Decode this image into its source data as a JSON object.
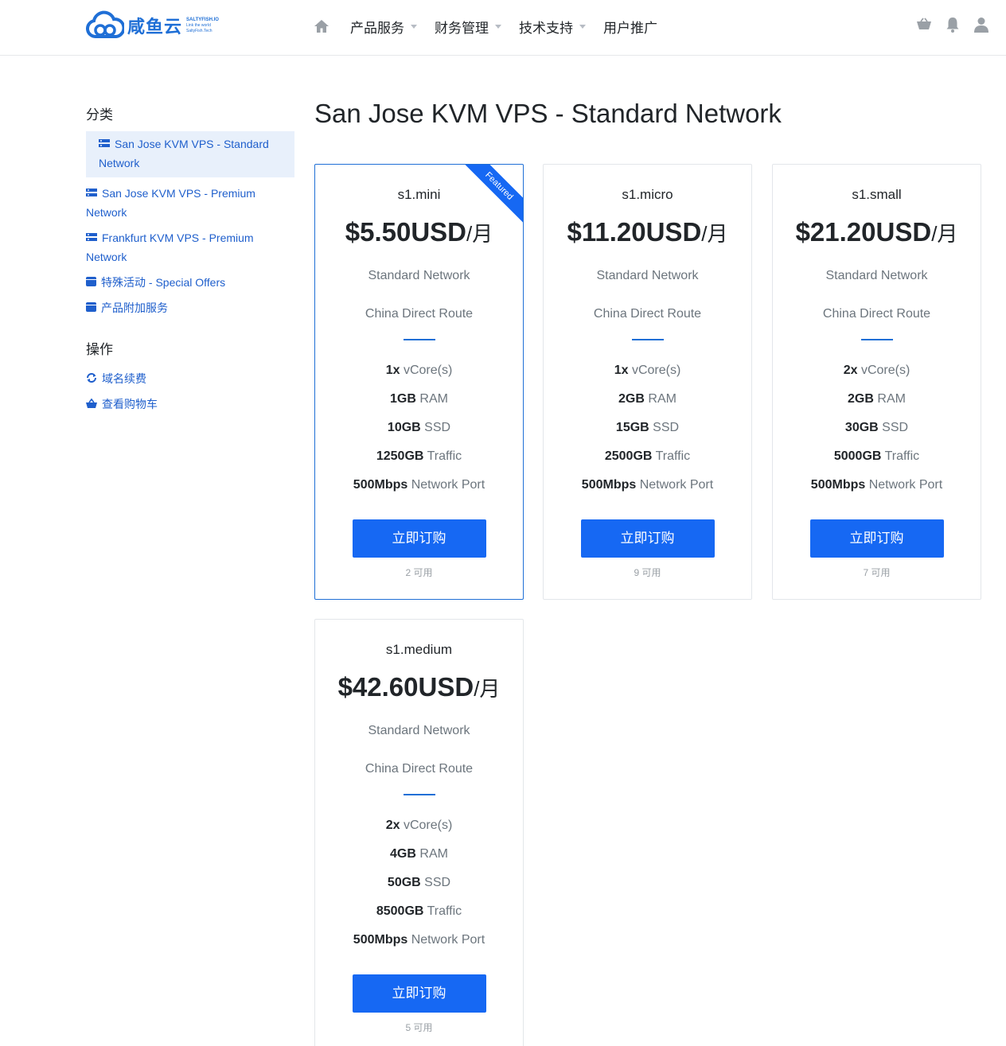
{
  "brand": {
    "name": "咸鱼云",
    "domain": "SALTYFISH.IO",
    "tagline1": "Link the world",
    "tagline2": "SaltyFish.Tech"
  },
  "nav": {
    "items": [
      {
        "label": "产品服务",
        "dropdown": true
      },
      {
        "label": "财务管理",
        "dropdown": true
      },
      {
        "label": "技术支持",
        "dropdown": true
      },
      {
        "label": "用户推广",
        "dropdown": false
      }
    ],
    "icons": [
      "home-icon",
      "cart-icon",
      "bell-icon",
      "user-icon"
    ]
  },
  "sidebar": {
    "categories_heading": "分类",
    "categories": [
      {
        "label": "San Jose KVM VPS - Standard Network",
        "icon": "server-icon",
        "active": true
      },
      {
        "label": "San Jose KVM VPS - Premium Network",
        "icon": "server-icon",
        "active": false
      },
      {
        "label": "Frankfurt KVM VPS - Premium Network",
        "icon": "server-icon",
        "active": false
      },
      {
        "label": "特殊活动 - Special Offers",
        "icon": "box-icon",
        "active": false
      },
      {
        "label": "产品附加服务",
        "icon": "box-icon",
        "active": false
      }
    ],
    "actions_heading": "操作",
    "actions": [
      {
        "label": "域名续费",
        "icon": "refresh-icon"
      },
      {
        "label": "查看购物车",
        "icon": "basket-icon"
      }
    ]
  },
  "main": {
    "title": "San Jose KVM VPS - Standard Network",
    "featured_label": "Featured",
    "order_label": "立即订购",
    "per_label": "/月",
    "products": [
      {
        "name": "s1.mini",
        "price": "$5.50USD",
        "featured": true,
        "desc1": "Standard Network",
        "desc2": "China Direct Route",
        "features": [
          {
            "value": "1x",
            "label": "vCore(s)"
          },
          {
            "value": "1GB",
            "label": "RAM"
          },
          {
            "value": "10GB",
            "label": "SSD"
          },
          {
            "value": "1250GB",
            "label": "Traffic"
          },
          {
            "value": "500Mbps",
            "label": "Network Port"
          }
        ],
        "available": "2 可用"
      },
      {
        "name": "s1.micro",
        "price": "$11.20USD",
        "featured": false,
        "desc1": "Standard Network",
        "desc2": "China Direct Route",
        "features": [
          {
            "value": "1x",
            "label": "vCore(s)"
          },
          {
            "value": "2GB",
            "label": "RAM"
          },
          {
            "value": "15GB",
            "label": "SSD"
          },
          {
            "value": "2500GB",
            "label": "Traffic"
          },
          {
            "value": "500Mbps",
            "label": "Network Port"
          }
        ],
        "available": "9 可用"
      },
      {
        "name": "s1.small",
        "price": "$21.20USD",
        "featured": false,
        "desc1": "Standard Network",
        "desc2": "China Direct Route",
        "features": [
          {
            "value": "2x",
            "label": "vCore(s)"
          },
          {
            "value": "2GB",
            "label": "RAM"
          },
          {
            "value": "30GB",
            "label": "SSD"
          },
          {
            "value": "5000GB",
            "label": "Traffic"
          },
          {
            "value": "500Mbps",
            "label": "Network Port"
          }
        ],
        "available": "7 可用"
      },
      {
        "name": "s1.medium",
        "price": "$42.60USD",
        "featured": false,
        "desc1": "Standard Network",
        "desc2": "China Direct Route",
        "features": [
          {
            "value": "2x",
            "label": "vCore(s)"
          },
          {
            "value": "4GB",
            "label": "RAM"
          },
          {
            "value": "50GB",
            "label": "SSD"
          },
          {
            "value": "8500GB",
            "label": "Traffic"
          },
          {
            "value": "500Mbps",
            "label": "Network Port"
          }
        ],
        "available": "5 可用"
      }
    ]
  },
  "colors": {
    "accent": "#1668f3",
    "link": "#1f5fcc",
    "muted": "#6c757d"
  }
}
